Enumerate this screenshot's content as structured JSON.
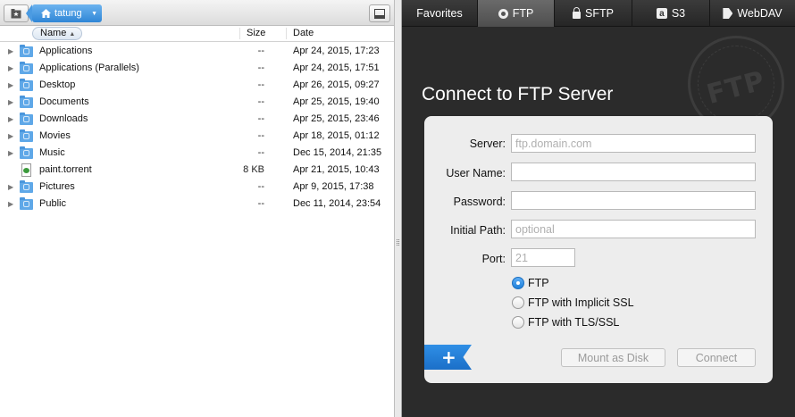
{
  "browser": {
    "path_label": "tatung",
    "columns": {
      "name": "Name",
      "size": "Size",
      "date": "Date"
    },
    "files": [
      {
        "name": "Applications",
        "size": "--",
        "date": "Apr 24, 2015, 17:23",
        "kind": "folder",
        "icon": "applications-folder-icon"
      },
      {
        "name": "Applications (Parallels)",
        "size": "--",
        "date": "Apr 24, 2015, 17:51",
        "kind": "folder",
        "icon": "parallels-folder-icon"
      },
      {
        "name": "Desktop",
        "size": "--",
        "date": "Apr 26, 2015, 09:27",
        "kind": "folder",
        "icon": "desktop-folder-icon"
      },
      {
        "name": "Documents",
        "size": "--",
        "date": "Apr 25, 2015, 19:40",
        "kind": "folder",
        "icon": "documents-folder-icon"
      },
      {
        "name": "Downloads",
        "size": "--",
        "date": "Apr 25, 2015, 23:46",
        "kind": "folder",
        "icon": "downloads-folder-icon"
      },
      {
        "name": "Movies",
        "size": "--",
        "date": "Apr 18, 2015, 01:12",
        "kind": "folder",
        "icon": "movies-folder-icon"
      },
      {
        "name": "Music",
        "size": "--",
        "date": "Dec 15, 2014, 21:35",
        "kind": "folder",
        "icon": "music-folder-icon"
      },
      {
        "name": "paint.torrent",
        "size": "8 KB",
        "date": "Apr 21, 2015, 10:43",
        "kind": "file",
        "icon": "torrent-file-icon"
      },
      {
        "name": "Pictures",
        "size": "--",
        "date": "Apr 9, 2015, 17:38",
        "kind": "folder",
        "icon": "pictures-folder-icon"
      },
      {
        "name": "Public",
        "size": "--",
        "date": "Dec 11, 2014, 23:54",
        "kind": "folder",
        "icon": "public-folder-icon"
      }
    ]
  },
  "tabs": [
    {
      "label": "Favorites",
      "icon": "",
      "active": false
    },
    {
      "label": "FTP",
      "icon": "ftp-icon",
      "active": true
    },
    {
      "label": "SFTP",
      "icon": "lock-icon",
      "active": false
    },
    {
      "label": "S3",
      "icon": "s3-icon",
      "active": false
    },
    {
      "label": "WebDAV",
      "icon": "webdav-icon",
      "active": false
    }
  ],
  "connect": {
    "heading": "Connect to FTP Server",
    "seal_text": "FTP",
    "server_label": "Server:",
    "server_placeholder": "ftp.domain.com",
    "server_value": "",
    "username_label": "User Name:",
    "username_value": "",
    "password_label": "Password:",
    "password_value": "",
    "initial_path_label": "Initial Path:",
    "initial_path_placeholder": "optional",
    "port_label": "Port:",
    "port_placeholder": "21",
    "protocols": [
      {
        "label": "FTP",
        "selected": true
      },
      {
        "label": "FTP with Implicit SSL",
        "selected": false
      },
      {
        "label": "FTP with TLS/SSL",
        "selected": false
      }
    ],
    "add_label": "+",
    "mount_label": "Mount as Disk",
    "connect_label": "Connect"
  },
  "colors": {
    "accent": "#2f86d6",
    "right_pane_bg": "#2b2b2b",
    "card_bg": "#ededed"
  }
}
